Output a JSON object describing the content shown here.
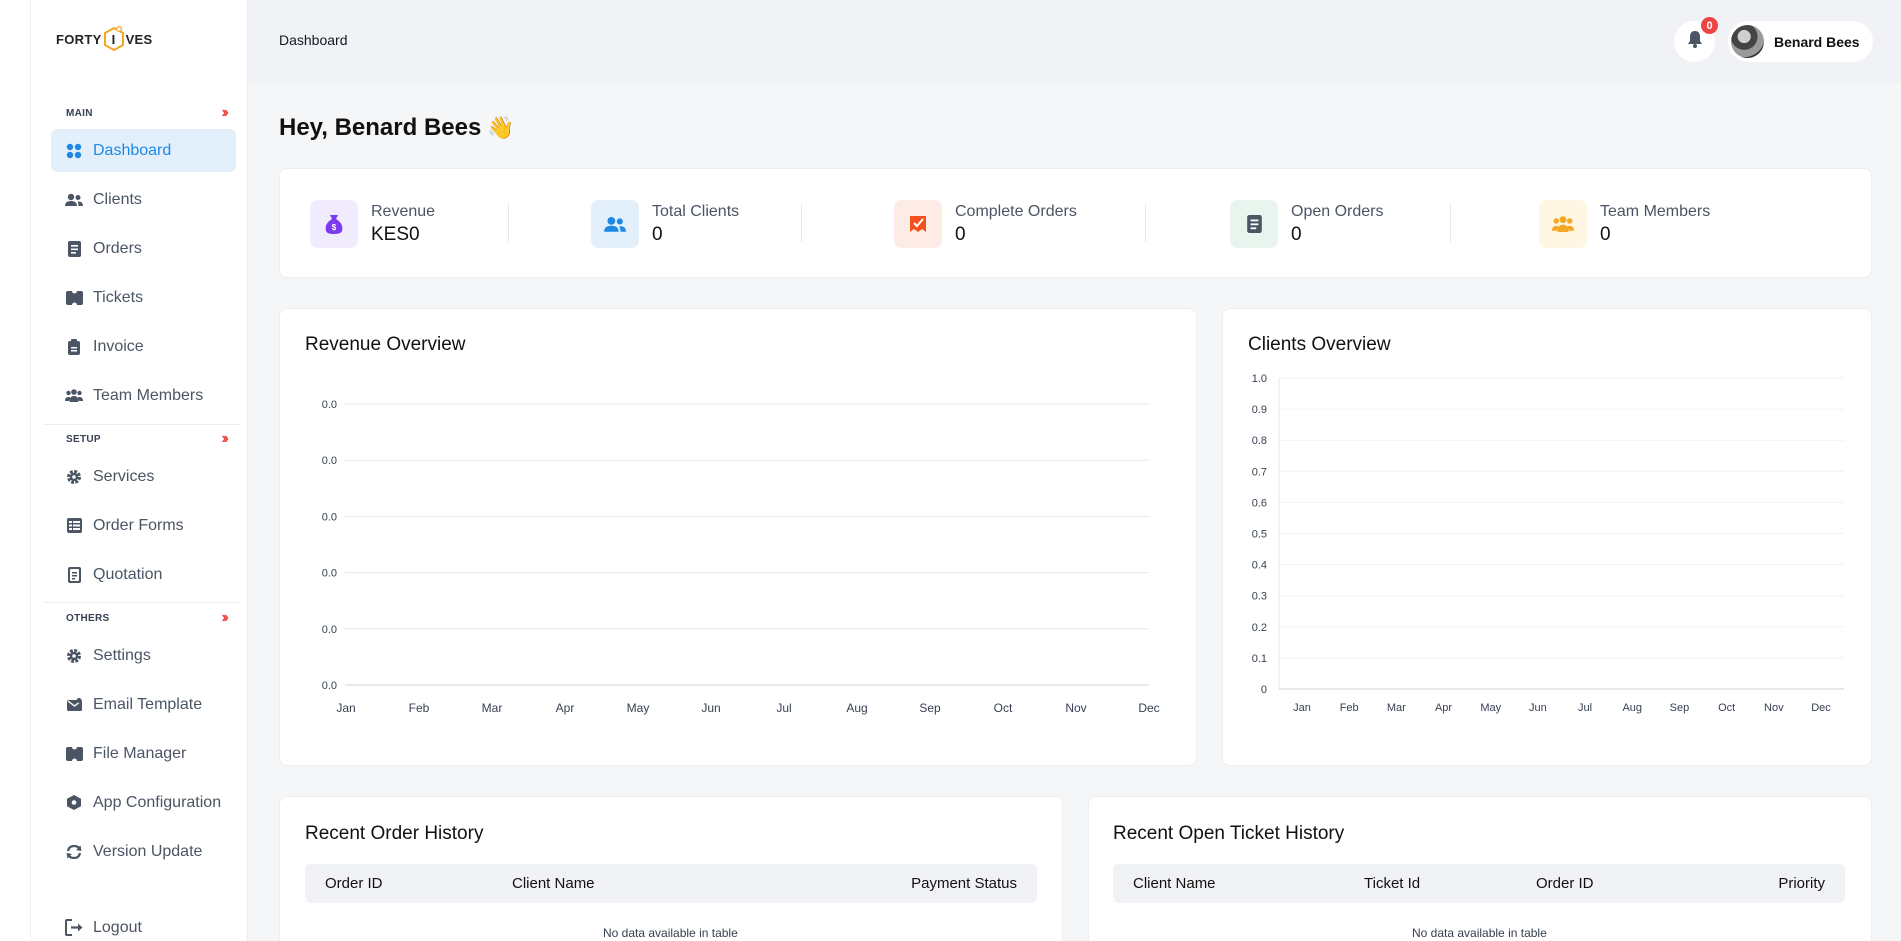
{
  "brand": {
    "logo_left": "FORTY",
    "logo_mid": "I",
    "logo_right": "VES"
  },
  "sidebar": {
    "sections": [
      {
        "label": "MAIN"
      },
      {
        "label": "SETUP"
      },
      {
        "label": "OTHERS"
      }
    ],
    "items": [
      {
        "label": "Dashboard",
        "icon": "grid-icon"
      },
      {
        "label": "Clients",
        "icon": "users-icon"
      },
      {
        "label": "Orders",
        "icon": "document-icon"
      },
      {
        "label": "Tickets",
        "icon": "ticket-icon"
      },
      {
        "label": "Invoice",
        "icon": "invoice-icon"
      },
      {
        "label": "Team Members",
        "icon": "team-icon"
      },
      {
        "label": "Services",
        "icon": "gear-icon"
      },
      {
        "label": "Order Forms",
        "icon": "form-icon"
      },
      {
        "label": "Quotation",
        "icon": "quotation-icon"
      },
      {
        "label": "Settings",
        "icon": "gear-icon"
      },
      {
        "label": "Email Template",
        "icon": "email-icon"
      },
      {
        "label": "File Manager",
        "icon": "file-manager-icon"
      },
      {
        "label": "App Configuration",
        "icon": "config-icon"
      },
      {
        "label": "Version Update",
        "icon": "update-icon"
      }
    ],
    "logout_label": "Logout"
  },
  "header": {
    "breadcrumb": "Dashboard",
    "notification_count": "0",
    "user_name": "Benard Bees"
  },
  "greeting": {
    "text": "Hey, Benard Bees",
    "emoji": "👋"
  },
  "stats": [
    {
      "label": "Revenue",
      "value": "KES0",
      "icon": "money-bag-icon",
      "color": "#7c3aed",
      "bg": "#f0ecfd"
    },
    {
      "label": "Total Clients",
      "value": "0",
      "icon": "users-icon",
      "color": "#1e88e5",
      "bg": "#e3f0fc"
    },
    {
      "label": "Complete Orders",
      "value": "0",
      "icon": "order-check-icon",
      "color": "#f4511e",
      "bg": "#fdece6"
    },
    {
      "label": "Open Orders",
      "value": "0",
      "icon": "document-icon",
      "color": "#4b5563",
      "bg": "#e8f5ee"
    },
    {
      "label": "Team Members",
      "value": "0",
      "icon": "team-icon",
      "color": "#f5a623",
      "bg": "#fff6e3"
    }
  ],
  "chart_data": [
    {
      "type": "line",
      "title": "Revenue Overview",
      "categories": [
        "Jan",
        "Feb",
        "Mar",
        "Apr",
        "May",
        "Jun",
        "Jul",
        "Aug",
        "Sep",
        "Oct",
        "Nov",
        "Dec"
      ],
      "y_tick_labels": [
        "0.0",
        "0.0",
        "0.0",
        "0.0",
        "0.0",
        "0.0"
      ],
      "series": [
        {
          "values": [
            0,
            0,
            0,
            0,
            0,
            0,
            0,
            0,
            0,
            0,
            0,
            0
          ]
        }
      ],
      "grid": true
    },
    {
      "type": "line",
      "title": "Clients Overview",
      "categories": [
        "Jan",
        "Feb",
        "Mar",
        "Apr",
        "May",
        "Jun",
        "Jul",
        "Aug",
        "Sep",
        "Oct",
        "Nov",
        "Dec"
      ],
      "y_tick_labels": [
        "1.0",
        "0.9",
        "0.8",
        "0.7",
        "0.6",
        "0.5",
        "0.4",
        "0.3",
        "0.2",
        "0.1",
        "0"
      ],
      "ylim": [
        0,
        1
      ],
      "series": [
        {
          "values": [
            0,
            0,
            0,
            0,
            0,
            0,
            0,
            0,
            0,
            0,
            0,
            0
          ]
        }
      ],
      "grid": true
    }
  ],
  "orders_table": {
    "title": "Recent Order History",
    "columns": [
      "Order ID",
      "Client Name",
      "Payment Status"
    ],
    "empty_text": "No data available in table"
  },
  "tickets_table": {
    "title": "Recent Open Ticket History",
    "columns": [
      "Client Name",
      "Ticket Id",
      "Order ID",
      "Priority"
    ],
    "empty_text": "No data available in table"
  }
}
